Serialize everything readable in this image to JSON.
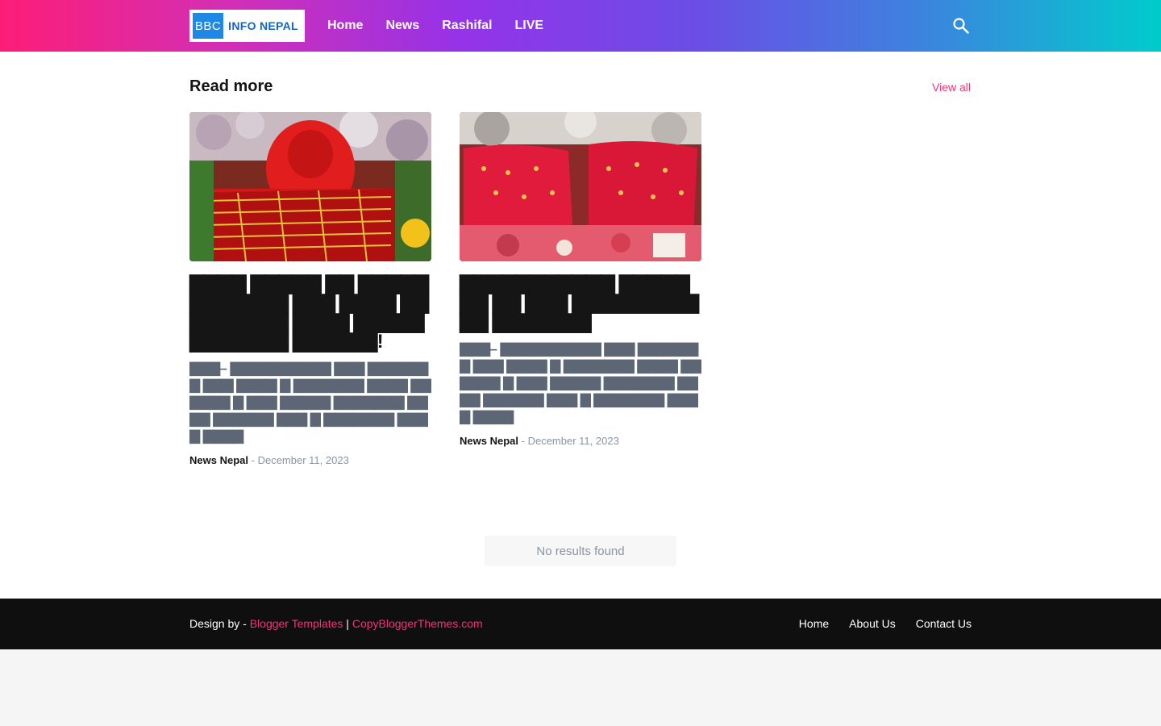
{
  "header": {
    "logo": {
      "bbc": "BBC",
      "main": "INFO NEPAL"
    },
    "nav": [
      "Home",
      "News",
      "Rashifal",
      "LIVE"
    ],
    "search_icon": "search-icon"
  },
  "section": {
    "title": "Read more",
    "view_all": "View all"
  },
  "posts": [
    {
      "title": "▇▇▇▇ ▇▇▇▇▇ ▇▇ ▇▇▇▇▇▇▇▇▇▇▇▇ ▇▇▇ ▇▇▇▇ ▇▇▇▇▇▇▇▇▇ ▇▇▇▇ ▇▇▇▇▇▇▇▇▇▇▇▇ ▇▇▇▇▇▇!",
      "snippet": "▇▇▇– ▇▇▇▇▇▇▇▇▇▇ ▇▇▇ ▇▇▇▇▇▇▇ ▇▇▇ ▇▇▇▇ ▇ ▇▇▇▇▇▇▇ ▇▇▇▇ ▇▇▇▇▇▇ ▇ ▇▇▇ ▇▇▇▇▇ ▇▇▇▇▇▇▇ ▇▇▇▇ ▇▇▇▇▇▇ ▇▇▇ ▇ ▇▇▇▇▇▇▇ ▇▇▇▇ ▇▇▇▇",
      "author": "News Nepal",
      "date": "December 11, 2023"
    },
    {
      "title": "▇▇▇▇▇▇▇▇▇▇▇ ▇▇▇▇▇▇▇ ▇▇ ▇▇▇ ▇▇▇▇▇▇▇▇▇▇▇ ▇▇▇▇▇▇▇",
      "snippet": "▇▇▇– ▇▇▇▇▇▇▇▇▇▇ ▇▇▇ ▇▇▇▇▇▇▇ ▇▇▇ ▇▇▇▇ ▇ ▇▇▇▇▇▇▇ ▇▇▇▇ ▇▇▇▇▇▇ ▇ ▇▇▇ ▇▇▇▇▇ ▇▇▇▇▇▇▇ ▇▇▇▇ ▇▇▇▇▇▇ ▇▇▇ ▇ ▇▇▇▇▇▇▇ ▇▇▇▇ ▇▇▇▇",
      "author": "News Nepal",
      "date": "December 11, 2023"
    }
  ],
  "meta_separator": "-",
  "no_results": "No results found",
  "footer": {
    "design_by": "Design by -",
    "link1": "Blogger Templates",
    "divider": "|",
    "link2": "CopyBloggerThemes.com",
    "nav": [
      "Home",
      "About Us",
      "Contact Us"
    ]
  },
  "colors": {
    "accent": "#fe2d78",
    "footer_bg": "#0f0f10",
    "meta_gray": "#8a94a2"
  }
}
